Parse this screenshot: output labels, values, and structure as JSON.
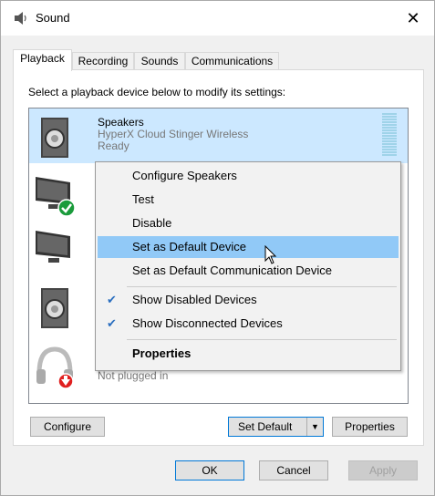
{
  "window": {
    "title": "Sound",
    "close_glyph": "✕"
  },
  "tabs": [
    {
      "label": "Playback",
      "active": true
    },
    {
      "label": "Recording"
    },
    {
      "label": "Sounds"
    },
    {
      "label": "Communications"
    }
  ],
  "instruction": "Select a playback device below to modify its settings:",
  "devices": [
    {
      "name": "Speakers",
      "sub": "HyperX Cloud Stinger Wireless",
      "status": "Ready",
      "icon": "speaker-icon",
      "selected": true
    },
    {
      "name": "",
      "sub": "",
      "status": "",
      "icon": "monitor-default-icon"
    },
    {
      "name": "",
      "sub": "",
      "status": "",
      "icon": "monitor-icon"
    },
    {
      "name": "",
      "sub": "",
      "status": "",
      "icon": "speaker-icon"
    },
    {
      "name": "",
      "sub": "",
      "status": "Not plugged in",
      "icon": "headphones-unplugged-icon"
    }
  ],
  "context_menu": {
    "items": [
      {
        "label": "Configure Speakers"
      },
      {
        "label": "Test"
      },
      {
        "label": "Disable"
      },
      {
        "label": "Set as Default Device",
        "highlighted": true
      },
      {
        "label": "Set as Default Communication Device"
      },
      {
        "label": "Show Disabled Devices",
        "checked": true
      },
      {
        "label": "Show Disconnected Devices",
        "checked": true
      },
      {
        "label": "Properties",
        "bold": true
      }
    ],
    "check_glyph": "✔"
  },
  "buttons": {
    "configure": "Configure",
    "set_default": "Set Default",
    "set_default_arrow": "▼",
    "properties": "Properties",
    "ok": "OK",
    "cancel": "Cancel",
    "apply": "Apply"
  },
  "colors": {
    "selection": "#cce8ff",
    "menu_hover": "#91c9f7",
    "accent": "#0078d7",
    "check_badge": "#1a9b3b",
    "unplugged_badge": "#e02020"
  }
}
